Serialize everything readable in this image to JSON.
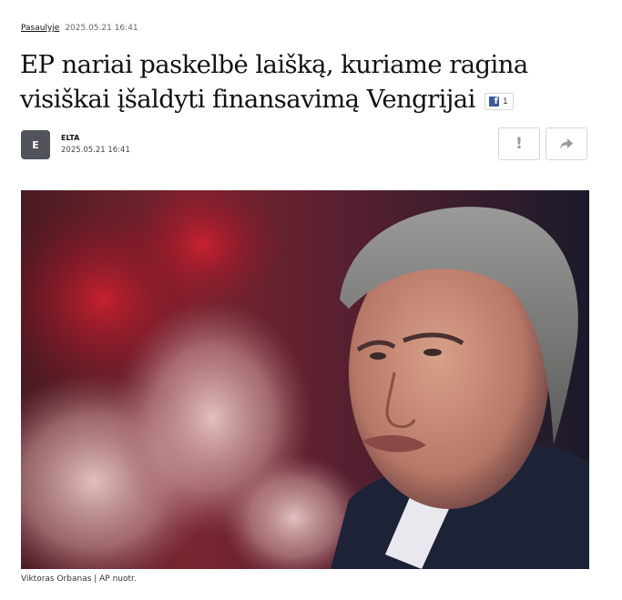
{
  "article": {
    "category": "Pasaulyje",
    "published": "2025.05.21 16:41",
    "title": "EP nariai paskelbė laišką, kuriame ragina visiškai įšaldyti finansavimą Vengrijai",
    "facebook_share_count": "1",
    "author": {
      "initial": "E",
      "name": "ELTA",
      "date": "2025.05.21 16:41"
    },
    "actions": {
      "report_icon": "exclamation-icon",
      "share_icon": "share-arrow-icon"
    },
    "image_caption": "Viktoras Orbanas | AP nuotr."
  },
  "colors": {
    "facebook": "#3b5998",
    "avatar_bg": "#50535a",
    "button_border": "#d6d6d6"
  }
}
